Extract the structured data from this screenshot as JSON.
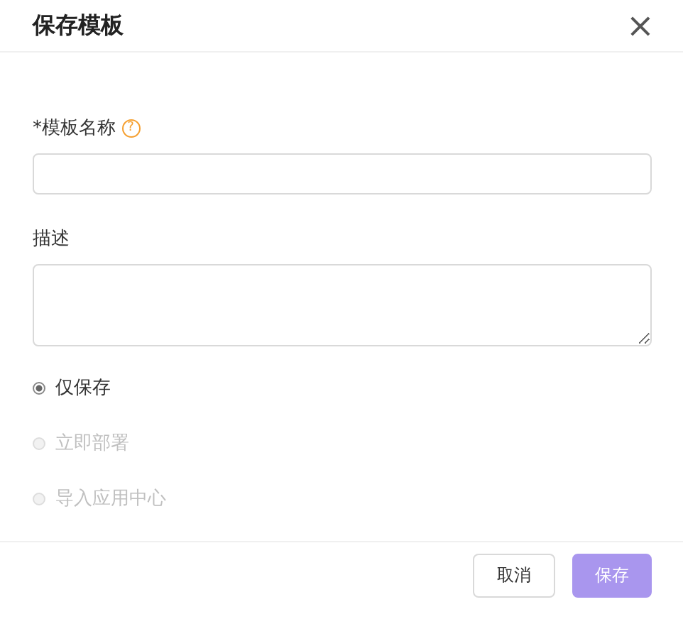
{
  "dialog": {
    "title": "保存模板",
    "close": "×"
  },
  "name_field": {
    "label": "*模板名称",
    "help": "?"
  },
  "description_field": {
    "label": "描述"
  },
  "options": [
    {
      "label": "仅保存",
      "selected": true,
      "disabled": false
    },
    {
      "label": "立即部署",
      "selected": false,
      "disabled": true
    },
    {
      "label": "导入应用中心",
      "selected": false,
      "disabled": true
    }
  ],
  "buttons": [
    {
      "label": "取消",
      "kind": "secondary",
      "disabled": false
    },
    {
      "label": "保存",
      "kind": "primary",
      "disabled": true
    }
  ]
}
